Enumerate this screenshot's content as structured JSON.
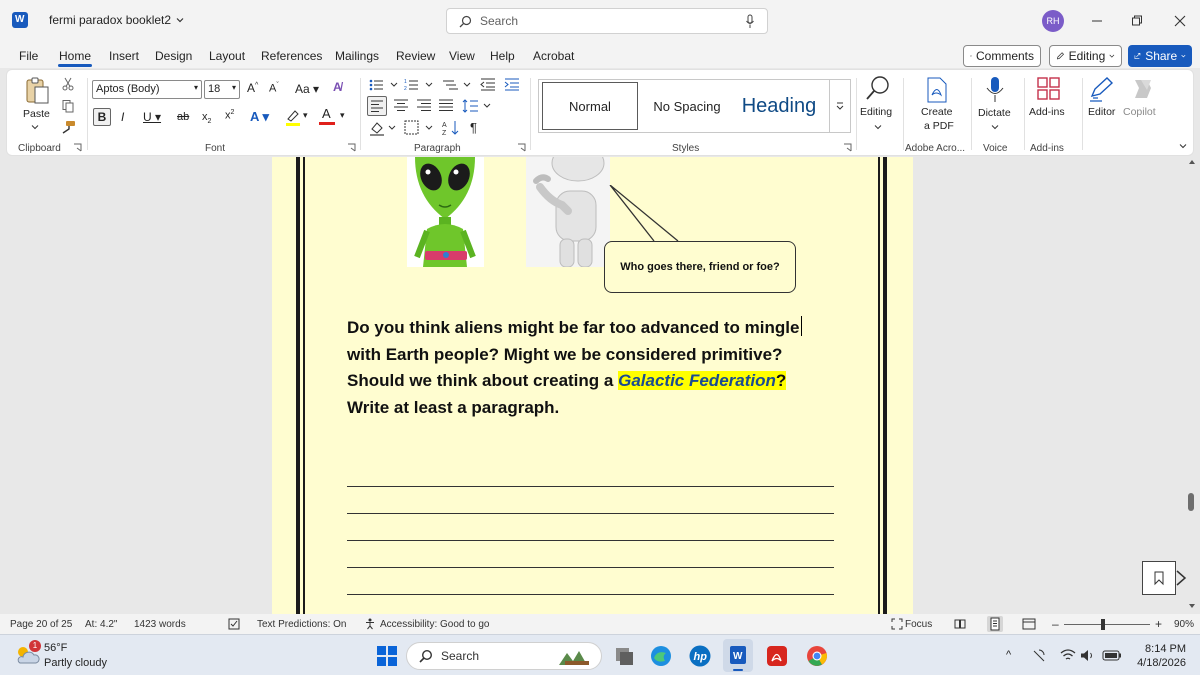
{
  "titlebar": {
    "doc_name": "fermi paradox booklet2",
    "search_placeholder": "Search",
    "user_initials": "RH"
  },
  "menu": {
    "tabs": [
      "File",
      "Home",
      "Insert",
      "Design",
      "Layout",
      "References",
      "Mailings",
      "Review",
      "View",
      "Help",
      "Acrobat"
    ],
    "active_tab": "Home",
    "comments_label": "Comments",
    "editing_label": "Editing",
    "share_label": "Share"
  },
  "ribbon": {
    "clipboard": {
      "paste": "Paste",
      "group": "Clipboard"
    },
    "font": {
      "family": "Aptos (Body)",
      "size": "18",
      "group": "Font"
    },
    "paragraph": {
      "group": "Paragraph"
    },
    "styles": {
      "normal": "Normal",
      "no_spacing": "No Spacing",
      "heading": "Heading",
      "group": "Styles"
    },
    "editing": {
      "label": "Editing"
    },
    "adobe": {
      "label_line1": "Create",
      "label_line2": "a PDF",
      "group": "Adobe Acro..."
    },
    "voice": {
      "label": "Dictate",
      "group": "Voice"
    },
    "addins": {
      "label": "Add-ins",
      "group": "Add-ins"
    },
    "editor": {
      "label": "Editor"
    },
    "copilot": {
      "label": "Copilot"
    }
  },
  "document": {
    "speech_bubble": "Who goes there, friend or foe?",
    "q1": "Do you think aliens might be far too advanced to mingle",
    "q2": "with Earth people?  Might we be considered primitive?",
    "q3_before": "Should we think about creating a ",
    "q3_highlight": "Galactic Federation",
    "q3_after": "?",
    "q4": "Write at least a paragraph."
  },
  "status": {
    "page": "Page 20 of 25",
    "at": "At: 4.2\"",
    "words": "1423 words",
    "predictions": "Text Predictions: On",
    "accessibility": "Accessibility: Good to go",
    "focus": "Focus",
    "zoom": "90%"
  },
  "taskbar": {
    "weather_temp": "56°F",
    "weather_desc": "Partly cloudy",
    "weather_badge": "1",
    "search": "Search",
    "time": "8:14 PM",
    "date": "4/18/2026"
  },
  "colors": {
    "accent": "#185abd",
    "page_bg": "#fffdd0",
    "highlight": "#ffff00",
    "highlight_text": "#1a4b91"
  }
}
